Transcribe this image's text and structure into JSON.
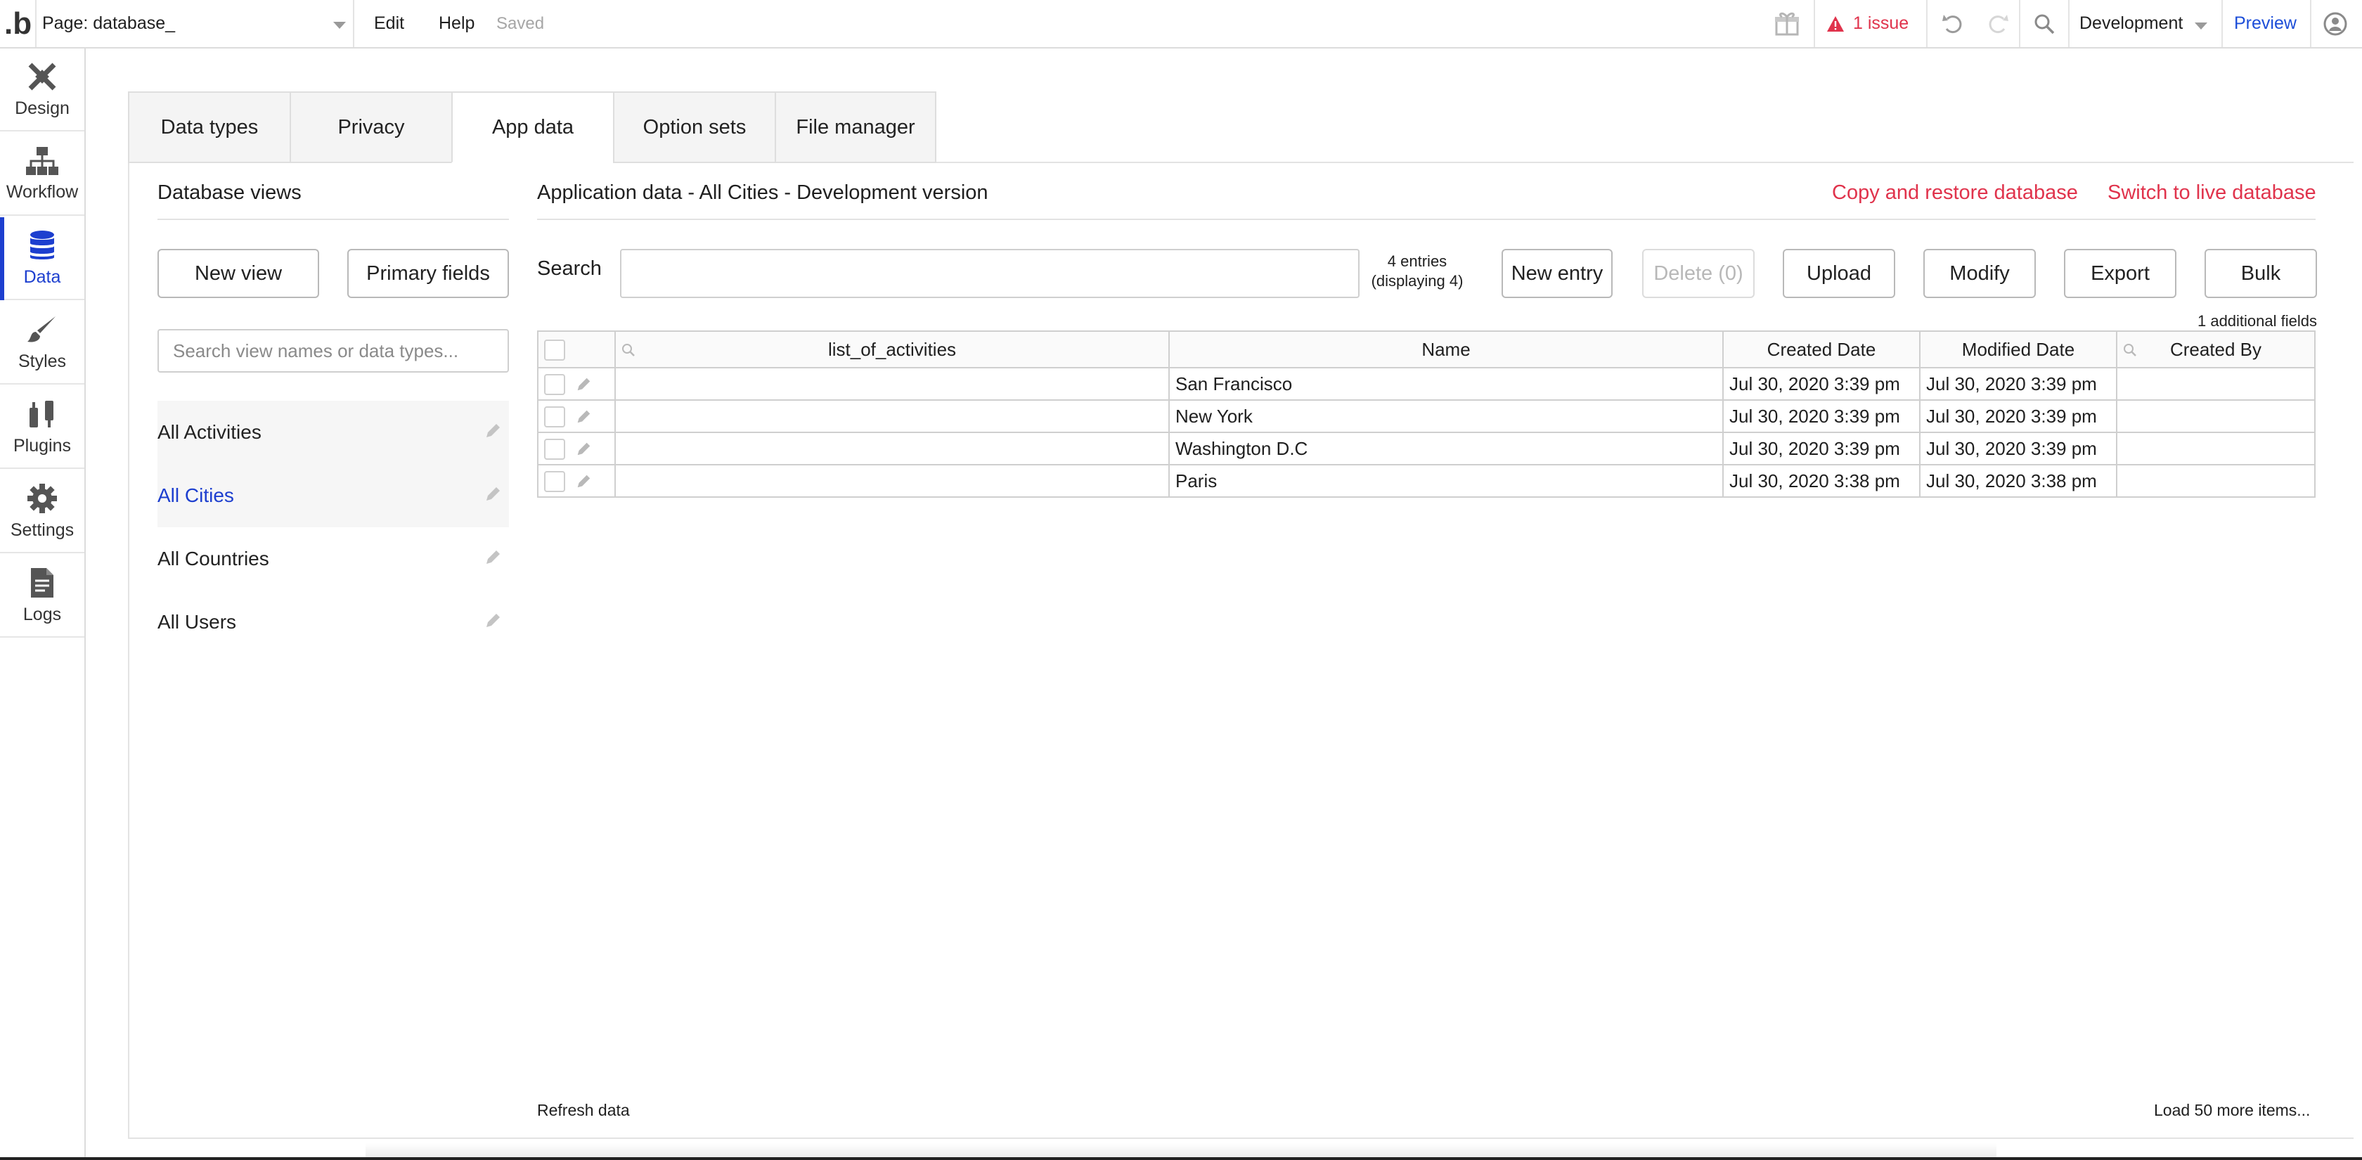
{
  "topbar": {
    "logo": ".b",
    "page_select": "Page: database_",
    "menu_edit": "Edit",
    "menu_help": "Help",
    "saved": "Saved",
    "issue_label": "1 issue",
    "environment": "Development",
    "preview": "Preview"
  },
  "nav": {
    "items": [
      {
        "label": "Design",
        "icon": "design-icon"
      },
      {
        "label": "Workflow",
        "icon": "workflow-icon"
      },
      {
        "label": "Data",
        "icon": "database-icon",
        "active": true
      },
      {
        "label": "Styles",
        "icon": "brush-icon"
      },
      {
        "label": "Plugins",
        "icon": "plug-icon"
      },
      {
        "label": "Settings",
        "icon": "gear-icon"
      },
      {
        "label": "Logs",
        "icon": "document-icon"
      }
    ]
  },
  "tabs": [
    {
      "label": "Data types"
    },
    {
      "label": "Privacy"
    },
    {
      "label": "App data",
      "active": true
    },
    {
      "label": "Option sets"
    },
    {
      "label": "File manager"
    }
  ],
  "views": {
    "title": "Database views",
    "new_view": "New view",
    "primary_fields": "Primary fields",
    "search_placeholder": "Search view names or data types...",
    "items": [
      {
        "label": "All Activities"
      },
      {
        "label": "All Cities",
        "active": true
      },
      {
        "label": "All Countries"
      },
      {
        "label": "All Users"
      }
    ]
  },
  "data": {
    "title": "Application data - All Cities - Development version",
    "copy_restore": "Copy and restore database",
    "switch_live": "Switch to live database",
    "search_label": "Search",
    "entries_line1": "4 entries",
    "entries_line2": "(displaying 4)",
    "buttons": {
      "new_entry": "New entry",
      "delete": "Delete (0)",
      "upload": "Upload",
      "modify": "Modify",
      "export": "Export",
      "bulk": "Bulk"
    },
    "additional_fields": "1 additional fields",
    "columns": [
      "list_of_activities",
      "Name",
      "Created Date",
      "Modified Date",
      "Created By"
    ],
    "rows": [
      {
        "list_of_activities": "",
        "name": "San Francisco",
        "created": "Jul 30, 2020 3:39 pm",
        "modified": "Jul 30, 2020 3:39 pm",
        "created_by": ""
      },
      {
        "list_of_activities": "",
        "name": "New York",
        "created": "Jul 30, 2020 3:39 pm",
        "modified": "Jul 30, 2020 3:39 pm",
        "created_by": ""
      },
      {
        "list_of_activities": "",
        "name": "Washington D.C",
        "created": "Jul 30, 2020 3:39 pm",
        "modified": "Jul 30, 2020 3:39 pm",
        "created_by": ""
      },
      {
        "list_of_activities": "",
        "name": "Paris",
        "created": "Jul 30, 2020 3:38 pm",
        "modified": "Jul 30, 2020 3:38 pm",
        "created_by": ""
      }
    ],
    "refresh": "Refresh data",
    "load_more": "Load 50 more items..."
  },
  "colors": {
    "accent_blue": "#1d3fcf",
    "alert_red": "#e0334c"
  }
}
